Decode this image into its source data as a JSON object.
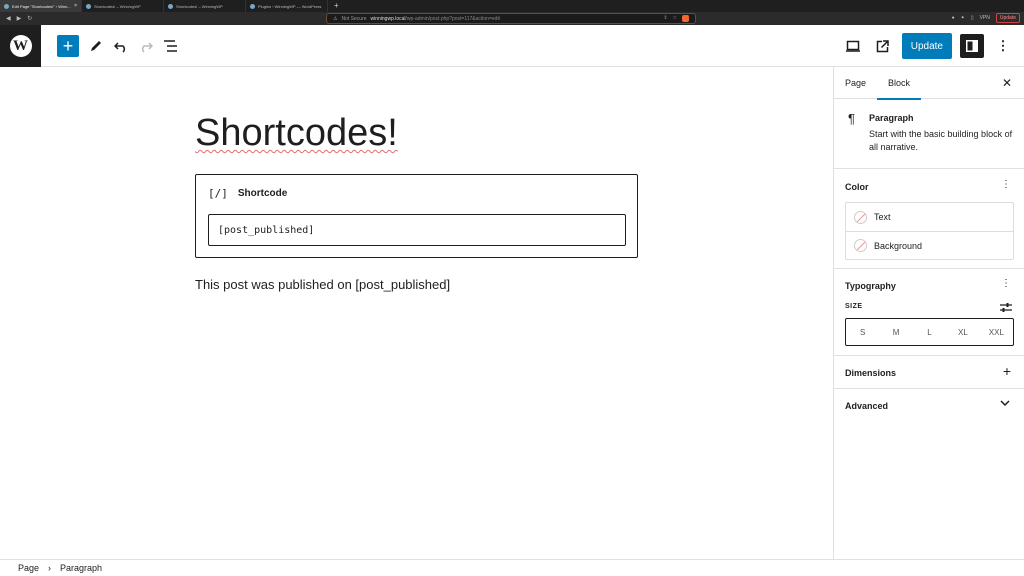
{
  "browser": {
    "tabs": [
      {
        "title": "Edit Page \"Shortcodes!\" ‹ Winn...",
        "active": true
      },
      {
        "title": "Shortcodes! – WinningWP",
        "active": false
      },
      {
        "title": "Shortcodes! – WinningWP",
        "active": false
      },
      {
        "title": "Plugins ‹ WinningWP — WordPress",
        "active": false
      }
    ],
    "not_secure": "Not Secure",
    "url_host": "winningwp.local",
    "url_path": "/wp-admin/post.php?post=117&action=edit",
    "vpn": "VPN",
    "update": "Update"
  },
  "toolbar": {
    "update_label": "Update"
  },
  "editor": {
    "post_title": "Shortcodes!",
    "shortcode_block": {
      "icon_text": "[/]",
      "label": "Shortcode",
      "value": "[post_published]"
    },
    "paragraph_text": "This post was published on [post_published]"
  },
  "sidebar": {
    "tabs": [
      "Page",
      "Block"
    ],
    "active_tab": "Block",
    "block_card": {
      "title": "Paragraph",
      "description": "Start with the basic building block of all narrative."
    },
    "color": {
      "title": "Color",
      "items": [
        "Text",
        "Background"
      ]
    },
    "typography": {
      "title": "Typography",
      "size_label": "SIZE",
      "sizes": [
        "S",
        "M",
        "L",
        "XL",
        "XXL"
      ]
    },
    "dimensions": {
      "title": "Dimensions"
    },
    "advanced": {
      "title": "Advanced"
    }
  },
  "breadcrumb": [
    "Page",
    "Paragraph"
  ],
  "colors": {
    "accent": "#007cba",
    "dark": "#1e1e1e"
  }
}
